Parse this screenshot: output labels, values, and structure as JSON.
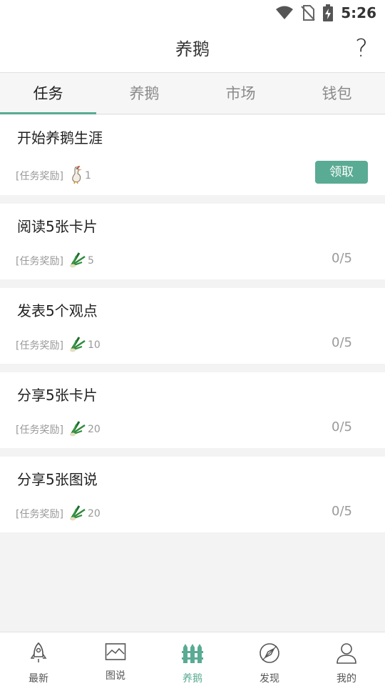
{
  "status_bar": {
    "time": "5:26",
    "icons": [
      "wifi-icon",
      "no-sim-icon",
      "battery-charging-icon"
    ]
  },
  "header": {
    "title": "养鹅",
    "help_label": "?"
  },
  "tabs": [
    {
      "label": "任务",
      "active": true
    },
    {
      "label": "养鹅",
      "active": false
    },
    {
      "label": "市场",
      "active": false
    },
    {
      "label": "钱包",
      "active": false
    }
  ],
  "tasks": [
    {
      "name": "开始养鹅生涯",
      "reward_label": "[任务奖励]",
      "reward_icon": "goose-icon",
      "reward_amount": "1",
      "action": "领取"
    },
    {
      "name": "阅读5张卡片",
      "reward_label": "[任务奖励]",
      "reward_icon": "scallion-icon",
      "reward_amount": "5",
      "progress": "0/5"
    },
    {
      "name": "发表5个观点",
      "reward_label": "[任务奖励]",
      "reward_icon": "scallion-icon",
      "reward_amount": "10",
      "progress": "0/5"
    },
    {
      "name": "分享5张卡片",
      "reward_label": "[任务奖励]",
      "reward_icon": "scallion-icon",
      "reward_amount": "20",
      "progress": "0/5"
    },
    {
      "name": "分享5张图说",
      "reward_label": "[任务奖励]",
      "reward_icon": "scallion-icon",
      "reward_amount": "20",
      "progress": "0/5"
    }
  ],
  "bottom_nav": [
    {
      "label": "最新",
      "icon": "rocket-icon",
      "active": false
    },
    {
      "label": "图说",
      "icon": "image-icon",
      "active": false
    },
    {
      "label": "养鹅",
      "icon": "fence-icon",
      "active": true
    },
    {
      "label": "发现",
      "icon": "compass-icon",
      "active": false
    },
    {
      "label": "我的",
      "icon": "user-icon",
      "active": false
    }
  ],
  "colors": {
    "accent": "#5aab93",
    "background": "#f3f3f3"
  }
}
